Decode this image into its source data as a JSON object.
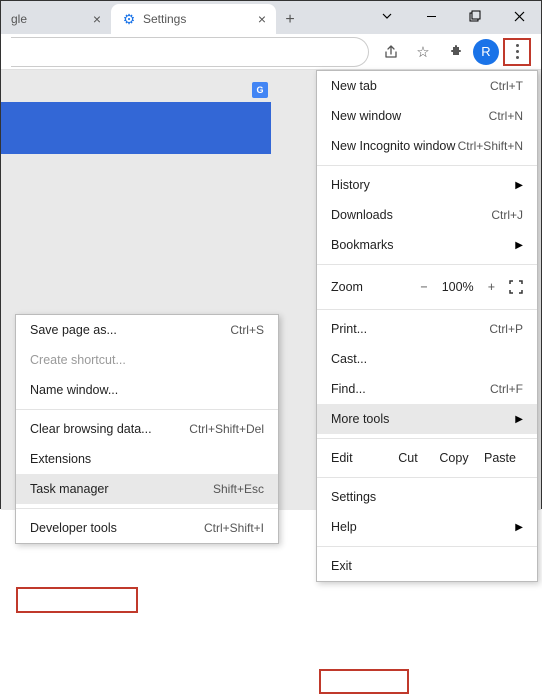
{
  "tabs": {
    "inactive_label": "gle",
    "active_label": "Settings"
  },
  "avatar_letter": "R",
  "gbadge": "G",
  "main_menu": {
    "new_tab": "New tab",
    "new_tab_sc": "Ctrl+T",
    "new_window": "New window",
    "new_window_sc": "Ctrl+N",
    "incognito": "New Incognito window",
    "incognito_sc": "Ctrl+Shift+N",
    "history": "History",
    "downloads": "Downloads",
    "downloads_sc": "Ctrl+J",
    "bookmarks": "Bookmarks",
    "zoom": "Zoom",
    "zoom_minus": "−",
    "zoom_val": "100%",
    "zoom_plus": "+",
    "print": "Print...",
    "print_sc": "Ctrl+P",
    "cast": "Cast...",
    "find": "Find...",
    "find_sc": "Ctrl+F",
    "more_tools": "More tools",
    "edit": "Edit",
    "cut": "Cut",
    "copy": "Copy",
    "paste": "Paste",
    "settings": "Settings",
    "help": "Help",
    "exit": "Exit"
  },
  "sub_menu": {
    "save_page": "Save page as...",
    "save_page_sc": "Ctrl+S",
    "create_shortcut": "Create shortcut...",
    "name_window": "Name window...",
    "clear_data": "Clear browsing data...",
    "clear_data_sc": "Ctrl+Shift+Del",
    "extensions": "Extensions",
    "task_manager": "Task manager",
    "task_manager_sc": "Shift+Esc",
    "dev_tools": "Developer tools",
    "dev_tools_sc": "Ctrl+Shift+I"
  }
}
